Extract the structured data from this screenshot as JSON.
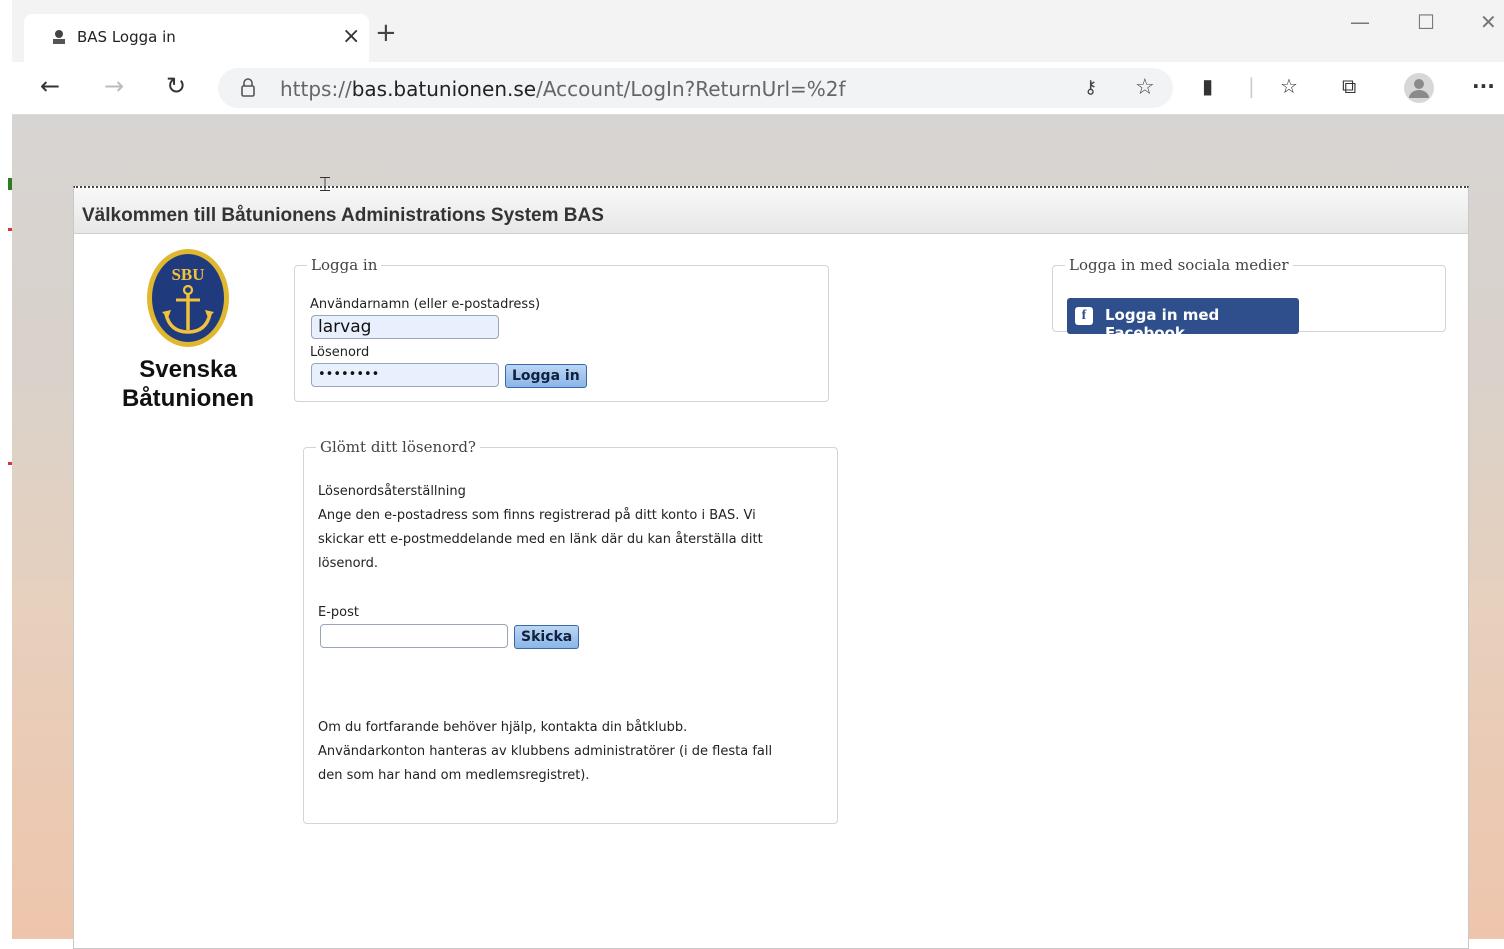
{
  "browser": {
    "tab_title": "BAS Logga in",
    "tab_close": "×",
    "new_tab": "+",
    "url_prefix": "https://",
    "url_domain": "bas.batunionen.se",
    "url_path": "/Account/LogIn?ReturnUrl=%2f",
    "window_minimize": "—",
    "window_maximize": "☐",
    "window_close": "✕",
    "more": "···"
  },
  "page": {
    "header_title": "Välkommen till Båtunionens Administrations System BAS",
    "logo": {
      "badge_text": "SBU",
      "line1": "Svenska",
      "line2": "Båtunionen"
    },
    "login": {
      "legend": "Logga in",
      "username_label": "Användarnamn (eller e-postadress)",
      "username_value": "larvag",
      "password_label": "Lösenord",
      "password_value": "••••••••",
      "submit_label": "Logga in"
    },
    "forgot": {
      "legend": "Glömt ditt lösenord?",
      "heading": "Lösenordsåterställning",
      "line1": "Ange den e-postadress som finns registrerad på ditt konto i BAS. Vi",
      "line2": "skickar ett e-postmeddelande med en länk där du kan återställa ditt",
      "line3": "lösenord.",
      "email_label": "E-post",
      "email_value": "",
      "submit_label": "Skicka",
      "help1": "Om du fortfarande behöver hjälp, kontakta din båtklubb.",
      "help2": "Användarkonton hanteras av klubbens administratörer (i de flesta fall",
      "help3": "den som har hand om medlemsregistret)."
    },
    "social": {
      "legend": "Logga in med sociala medier",
      "facebook_icon": "f",
      "facebook_label": "Logga in med Facebook"
    }
  }
}
